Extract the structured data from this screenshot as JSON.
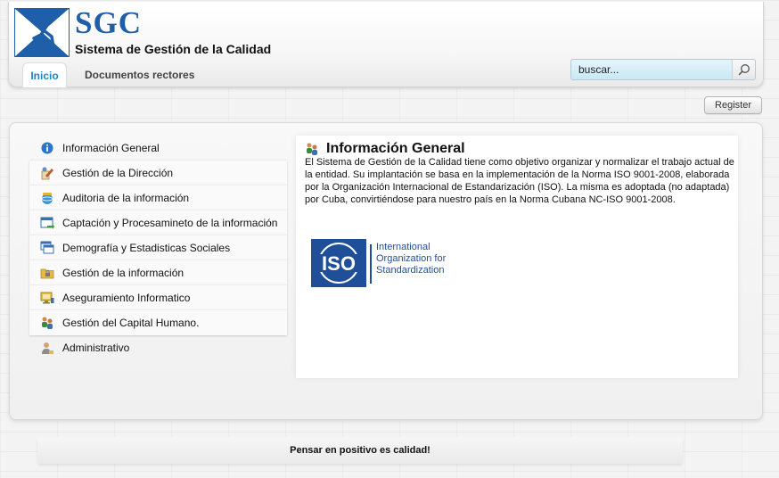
{
  "brand": {
    "short": "SGC",
    "subtitle": "Sistema de Gestión de la Calidad",
    "color": "#1f5ea8"
  },
  "nav": {
    "tabs": [
      {
        "label": "Inicio",
        "active": true
      },
      {
        "label": "Documentos rectores",
        "active": false
      }
    ]
  },
  "search": {
    "placeholder": "buscar...",
    "icon": "search-icon"
  },
  "account": {
    "register_label": "Register"
  },
  "sidebar": {
    "items": [
      {
        "label": "Información General",
        "icon": "info-icon"
      },
      {
        "label": "Gestión de la Dirección",
        "icon": "edit-pen-icon"
      },
      {
        "label": "Auditoria de la información",
        "icon": "globe-icon"
      },
      {
        "label": "Captación y Procesamineto de la información",
        "icon": "window-arrow-icon"
      },
      {
        "label": "Demografía y Estadisticas Sociales",
        "icon": "windows-icon"
      },
      {
        "label": "Gestión de la información",
        "icon": "folder-lock-icon"
      },
      {
        "label": "Aseguramiento Informatico",
        "icon": "monitor-icon"
      },
      {
        "label": "Gestión del Capital Humano.",
        "icon": "users-icon"
      },
      {
        "label": "Administrativo",
        "icon": "user-icon"
      }
    ]
  },
  "content": {
    "title": "Información General",
    "title_icon": "users-icon",
    "body": "El Sistema de Gestión de la Calidad tiene como objetivo organizar y normalizar el trabajo actual de la entidad. Su implantación se basa en la implementación de la Norma ISO 9001-2008, elaborada por la Organización Internacional de Estandarización (ISO). La misma es adoptada (no adaptada) por Cuba, convirtiéndose para nuestro país en la Norma Cubana NC-ISO 9001-2008.",
    "iso_logo": {
      "mark": "ISO",
      "line1": "International",
      "line2": "Organization for",
      "line3": "Standardization",
      "color": "#1f4f99"
    }
  },
  "footer": {
    "text": "Pensar en positivo es calidad!"
  },
  "colors": {
    "accent": "#1b86c6",
    "search_bg": "#d6f0f9"
  }
}
